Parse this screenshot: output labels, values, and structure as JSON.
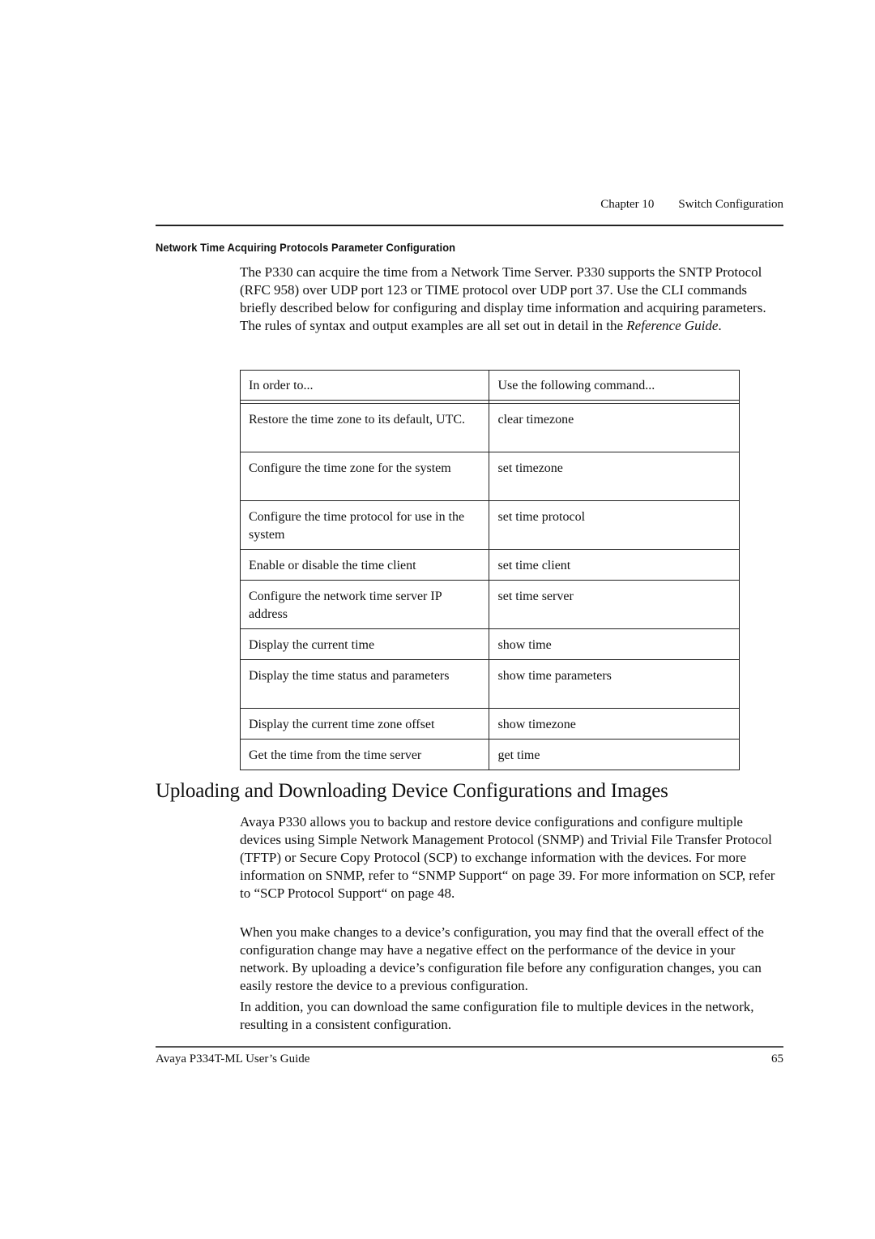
{
  "running_head": {
    "chapter": "Chapter 10",
    "section": "Switch Configuration"
  },
  "subsection_title": "Network Time Acquiring Protocols Parameter Configuration",
  "intro": {
    "text_before_ref": "The P330 can acquire the time from a Network Time Server. P330 supports the SNTP Protocol (RFC 958) over UDP port 123 or TIME protocol over UDP port 37. Use the CLI commands briefly described below for configuring and display time information and acquiring parameters. The rules of syntax and output examples are all set out in detail in the ",
    "reference": "Reference Guide",
    "text_after_ref": "."
  },
  "table": {
    "headers": [
      "In order to...",
      "Use the following command..."
    ],
    "rows": [
      {
        "purpose": "Restore the time zone to its default, UTC.",
        "command": "clear timezone"
      },
      {
        "purpose": "Configure the time zone for the system",
        "command": "set timezone"
      },
      {
        "purpose": "Configure the time protocol for use in the system",
        "command": "set time protocol"
      },
      {
        "purpose": "Enable or disable the time client",
        "command": "set time client"
      },
      {
        "purpose": "Configure the network time server IP address",
        "command": "set time server"
      },
      {
        "purpose": "Display the current time",
        "command": "show time"
      },
      {
        "purpose": "Display the time status and parameters",
        "command": "show time parameters"
      },
      {
        "purpose": "Display the current time zone offset",
        "command": "show timezone"
      },
      {
        "purpose": "Get the time from the time server",
        "command": "get time"
      }
    ]
  },
  "section_title": "Uploading and Downloading Device Configurations and Images",
  "paragraphs": [
    "Avaya P330 allows you to backup and restore device configurations and configure multiple devices using Simple Network Management Protocol (SNMP) and Trivial File Transfer Protocol (TFTP) or Secure Copy Protocol (SCP) to exchange information with the devices. For more information on SNMP, refer to “SNMP Support“ on page 39. For more information on SCP, refer to “SCP Protocol Support“ on page 48.",
    "When you make changes to a device’s configuration, you may find that the overall effect of the configuration change may have a negative effect on the performance of the device in your network. By uploading a device’s configuration file before any configuration changes, you can easily restore the device to a previous configuration.",
    "In addition, you can download the same configuration file to multiple devices in the network, resulting in a consistent configuration."
  ],
  "footer": {
    "guide_title": "Avaya P334T-ML User’s Guide",
    "page_number": "65"
  }
}
